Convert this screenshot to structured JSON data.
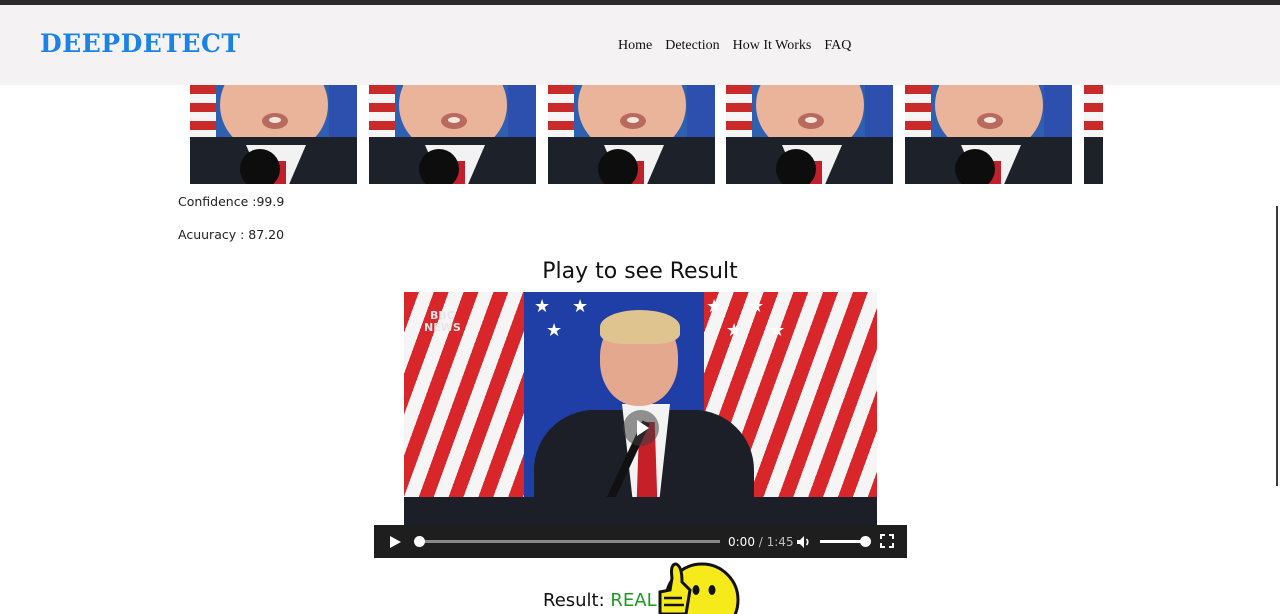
{
  "brand": "DEEPDETECT",
  "nav": {
    "items": [
      {
        "label": "Home"
      },
      {
        "label": "Detection"
      },
      {
        "label": "How It Works"
      },
      {
        "label": "FAQ"
      }
    ]
  },
  "stats": {
    "confidence": "Confidence :99.9",
    "accuracy": "Acuuracy : 87.20"
  },
  "video_section": {
    "title": "Play to see Result",
    "watermark_line1": "BBC",
    "watermark_line2": "NEWS"
  },
  "player": {
    "current_time": "0:00",
    "separator": " / ",
    "duration": "1:45",
    "progress": 0.0,
    "volume": 1.0
  },
  "result": {
    "label": "Result: ",
    "value": "REAL"
  },
  "colors": {
    "brand": "#1b82e6",
    "real": "#1e9a1e",
    "navbar_bg": "#f4f2f3"
  },
  "icons": [
    "play-icon",
    "volume-icon",
    "fullscreen-icon",
    "thumbs-up-icon"
  ]
}
